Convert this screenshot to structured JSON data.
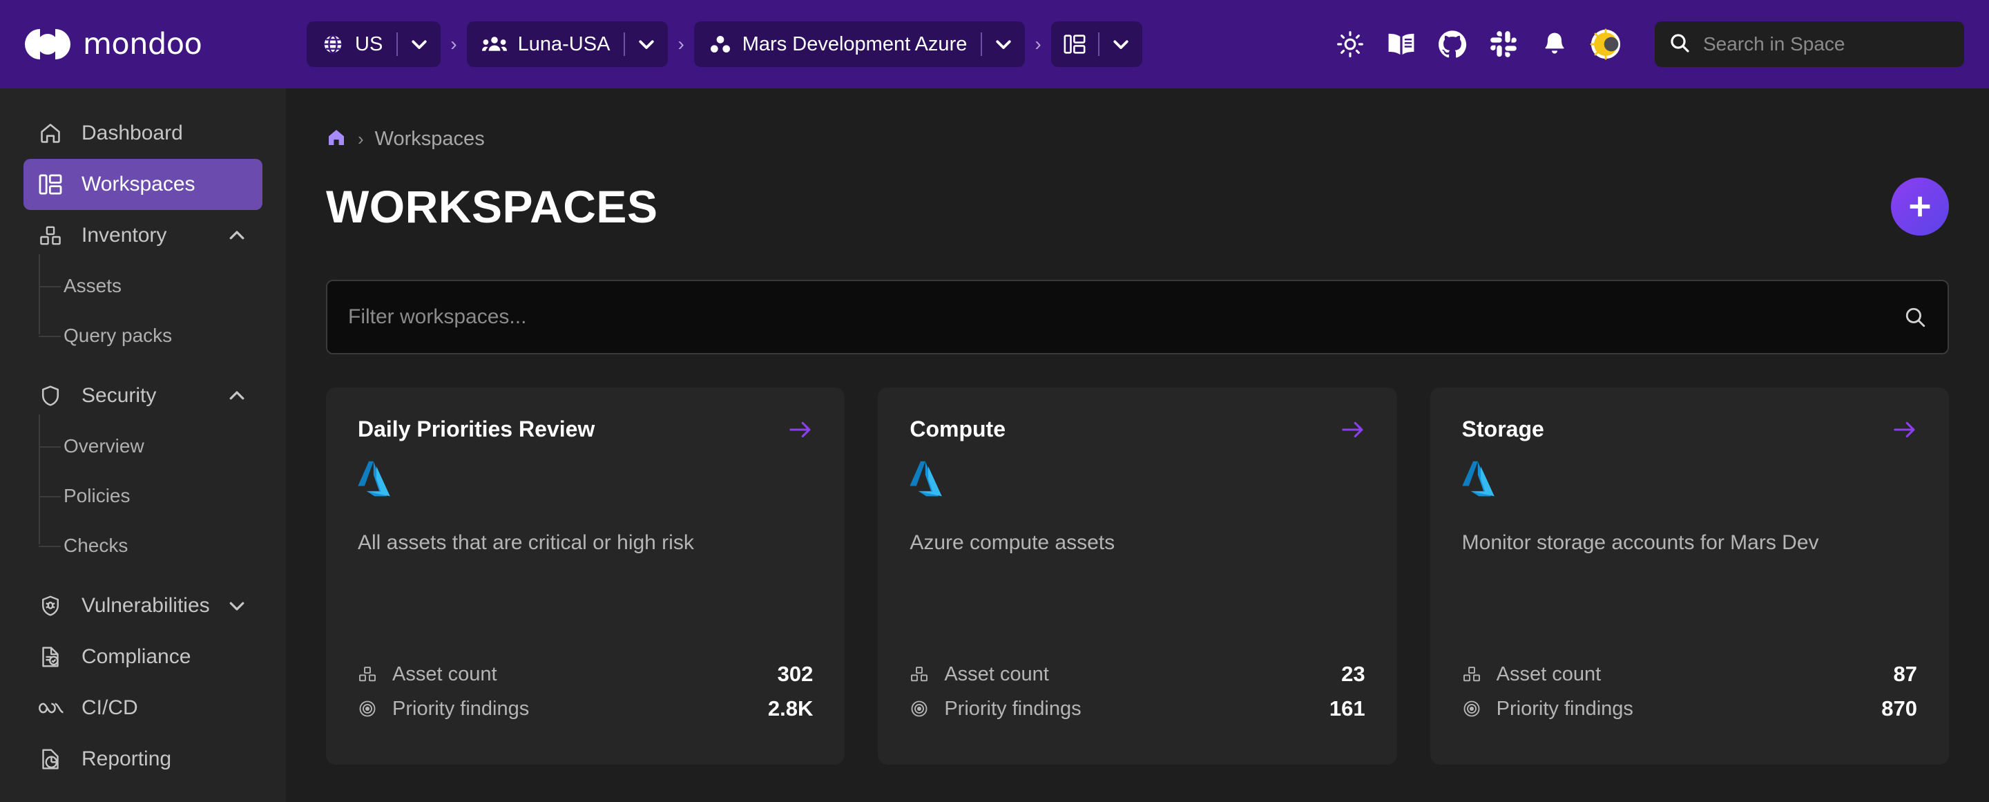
{
  "brand": {
    "name": "mondoo",
    "logo_icon": "mondoo-logo-icon"
  },
  "topbar": {
    "breadcrumbs": [
      {
        "icon": "globe-icon",
        "label": "US",
        "caret": "chevron-down-icon"
      },
      {
        "icon": "organization-icon",
        "label": "Luna-USA",
        "caret": "chevron-down-icon"
      },
      {
        "icon": "space-icon",
        "label": "Mars Development Azure",
        "caret": "chevron-down-icon"
      },
      {
        "icon": "workspaces-icon",
        "label": "",
        "caret": "chevron-down-icon"
      }
    ],
    "separator": "›",
    "actions": [
      {
        "icon": "status-sun-icon",
        "name": "status-icon"
      },
      {
        "icon": "book-icon",
        "name": "docs-icon"
      },
      {
        "icon": "github-icon",
        "name": "github-icon"
      },
      {
        "icon": "slack-icon",
        "name": "slack-icon"
      },
      {
        "icon": "bell-icon",
        "name": "notifications-icon"
      },
      {
        "icon": "theme-toggle-icon",
        "name": "theme-toggle-icon"
      }
    ],
    "search": {
      "placeholder": "Search in Space",
      "icon": "search-icon"
    }
  },
  "sidebar": {
    "items": [
      {
        "label": "Dashboard",
        "icon": "home-icon",
        "active": false,
        "expandable": false
      },
      {
        "label": "Workspaces",
        "icon": "workspaces-icon",
        "active": true,
        "expandable": false
      },
      {
        "label": "Inventory",
        "icon": "inventory-icon",
        "active": false,
        "expandable": true,
        "expanded": true
      },
      {
        "label": "Security",
        "icon": "shield-icon",
        "active": false,
        "expandable": true,
        "expanded": true
      },
      {
        "label": "Vulnerabilities",
        "icon": "bug-shield-icon",
        "active": false,
        "expandable": true,
        "expanded": false
      },
      {
        "label": "Compliance",
        "icon": "compliance-doc-icon",
        "active": false,
        "expandable": false
      },
      {
        "label": "CI/CD",
        "icon": "cicd-infinity-icon",
        "active": false,
        "expandable": false
      },
      {
        "label": "Reporting",
        "icon": "reporting-chart-icon",
        "active": false,
        "expandable": false
      }
    ],
    "inventory_children": [
      {
        "label": "Assets"
      },
      {
        "label": "Query packs"
      }
    ],
    "security_children": [
      {
        "label": "Overview"
      },
      {
        "label": "Policies"
      },
      {
        "label": "Checks"
      }
    ]
  },
  "main": {
    "breadcrumb": {
      "home_icon": "home-icon",
      "separator": "›",
      "current": "Workspaces"
    },
    "page_title": "WORKSPACES",
    "add_button": {
      "icon": "plus-icon",
      "label": "Add workspace"
    },
    "filter": {
      "placeholder": "Filter workspaces...",
      "value": "",
      "icon": "search-icon"
    },
    "cards": [
      {
        "title": "Daily Priorities Review",
        "provider_logo": "azure-logo-icon",
        "description": "All assets that are critical or high risk",
        "arrow_icon": "arrow-right-icon",
        "stats": [
          {
            "icon": "asset-count-icon",
            "label": "Asset count",
            "value": "302"
          },
          {
            "icon": "priority-findings-icon",
            "label": "Priority findings",
            "value": "2.8K"
          }
        ]
      },
      {
        "title": "Compute",
        "provider_logo": "azure-logo-icon",
        "description": "Azure compute assets",
        "arrow_icon": "arrow-right-icon",
        "stats": [
          {
            "icon": "asset-count-icon",
            "label": "Asset count",
            "value": "23"
          },
          {
            "icon": "priority-findings-icon",
            "label": "Priority findings",
            "value": "161"
          }
        ]
      },
      {
        "title": "Storage",
        "provider_logo": "azure-logo-icon",
        "description": "Monitor storage accounts for Mars Dev",
        "arrow_icon": "arrow-right-icon",
        "stats": [
          {
            "icon": "asset-count-icon",
            "label": "Asset count",
            "value": "87"
          },
          {
            "icon": "priority-findings-icon",
            "label": "Priority findings",
            "value": "870"
          }
        ]
      }
    ]
  },
  "colors": {
    "brand_purple": "#3f1581",
    "accent_purple": "#8b3ff0",
    "sidebar_active": "#6b4cae",
    "surface": "#262626",
    "background": "#1e1e1e",
    "azure_blue": "#29a3e8"
  }
}
